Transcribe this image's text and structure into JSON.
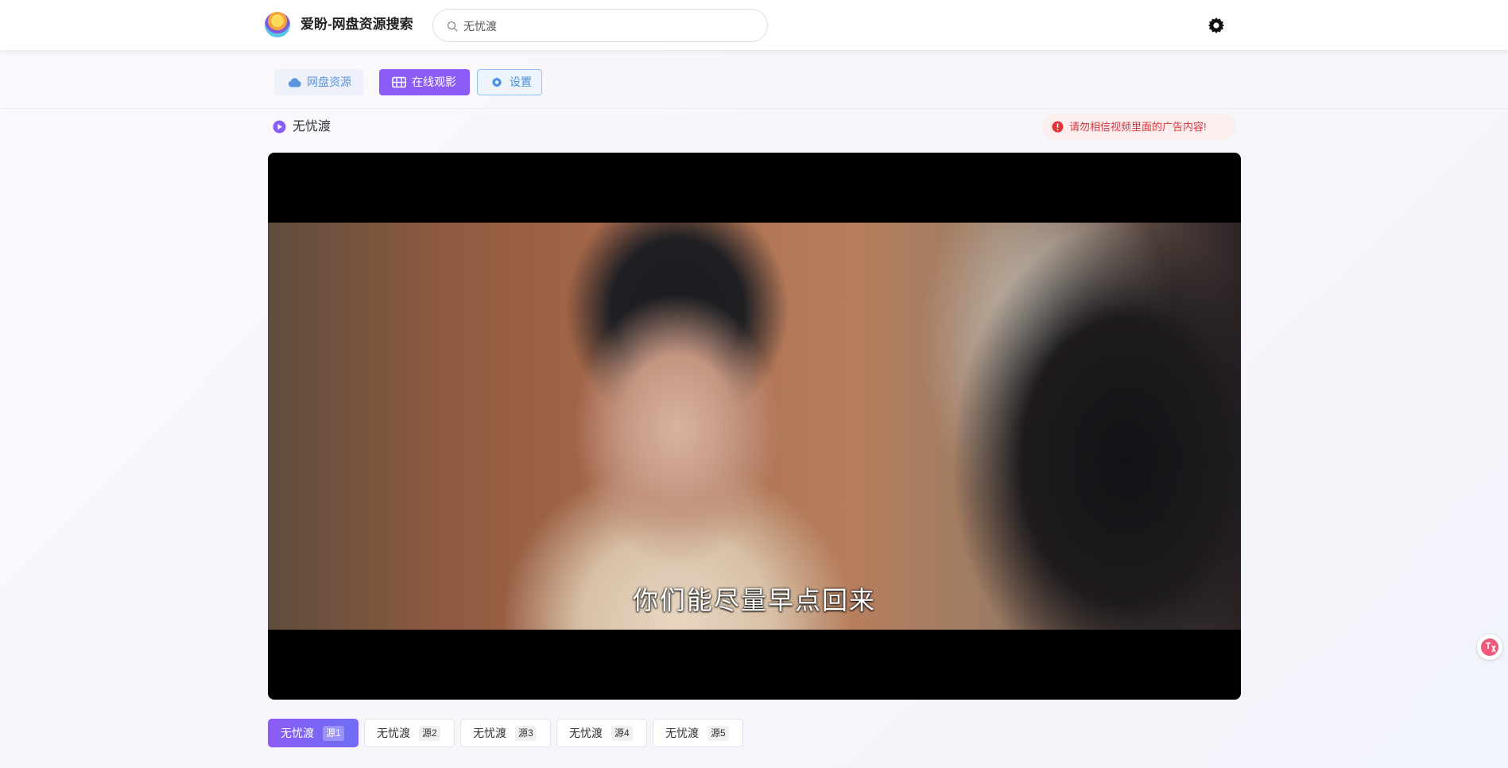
{
  "header": {
    "app_title": "爱盼-网盘资源搜索",
    "search": {
      "value": "无忧渡",
      "placeholder": ""
    }
  },
  "nav": {
    "tabs": [
      {
        "label": "网盘资源",
        "icon": "cloud-icon"
      },
      {
        "label": "在线观影",
        "icon": "film-icon",
        "active": true
      },
      {
        "label": "设置",
        "icon": "gear-icon"
      }
    ]
  },
  "video": {
    "title": "无忧渡",
    "warning": "请勿相信视频里面的广告内容!",
    "subtitle": "你们能尽量早点回来"
  },
  "sources": [
    {
      "name": "无忧渡",
      "badge": "源1",
      "active": true
    },
    {
      "name": "无忧渡",
      "badge": "源2"
    },
    {
      "name": "无忧渡",
      "badge": "源3"
    },
    {
      "name": "无忧渡",
      "badge": "源4"
    },
    {
      "name": "无忧渡",
      "badge": "源5"
    }
  ],
  "colors": {
    "accent": "#8b5cf6",
    "warning": "#d9363e",
    "link": "#4a8fe0"
  }
}
